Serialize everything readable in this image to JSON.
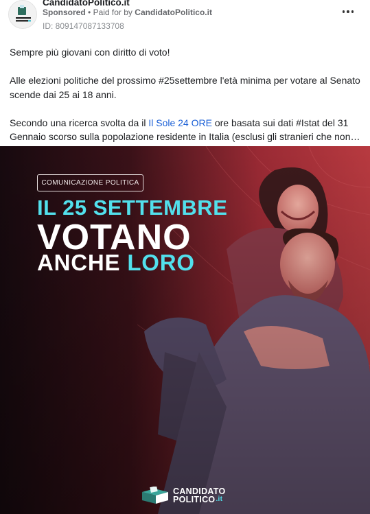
{
  "post": {
    "page_name": "CandidatoPolitico.it",
    "sponsored_label": "Sponsored",
    "separator": "•",
    "paid_for_prefix": "Paid for by",
    "advertiser": "CandidatoPolitico.it",
    "ad_id": "ID: 809147087133708",
    "more_icon": "more-horizontal-icon",
    "avatar_text": "CANDIDATO POLITICO.IT"
  },
  "text": {
    "line1": "Sempre più giovani con diritto di voto!",
    "para2": "Alle elezioni politiche del prossimo #25settembre l'età minima per votare al Senato scende dai 25 ai 18 anni.",
    "para3_before": "Secondo una ricerca svolta da il ",
    "para3_link": "Il Sole 24 ORE",
    "para3_after": " ore basata sui dati #Istat del 31 Gennaio scorso sulla popolazione residente in Italia (esclusi gli stranieri che non…"
  },
  "creative": {
    "badge": "COMUNICAZIONE POLITICA",
    "headline_1": "IL 25 SETTEMBRE",
    "headline_2": "VOTANO",
    "headline_3a": "ANCHE ",
    "headline_3b": "LORO",
    "brand_line1": "CANDIDATO",
    "brand_line2": "POLITICO",
    "brand_suffix": ".it",
    "colors": {
      "accent": "#52e0ec",
      "overlay_red": "#c0303a",
      "dark": "#1a0d12"
    }
  }
}
